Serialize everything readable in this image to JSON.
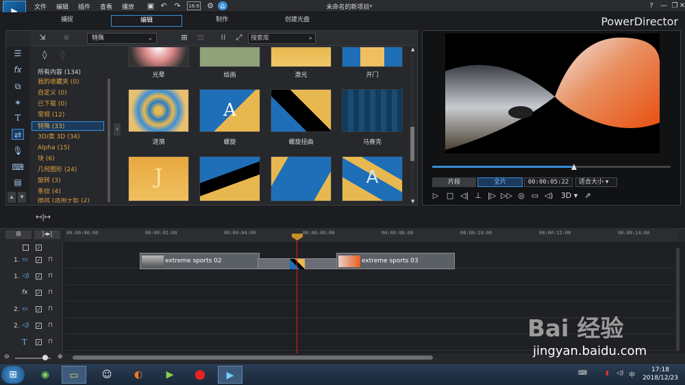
{
  "menu": [
    "文件",
    "编辑",
    "插件",
    "查看",
    "播放"
  ],
  "doc_title": "未命名的新项目*",
  "modes": {
    "capture": "捕捉",
    "edit": "编辑",
    "produce": "制作",
    "disc": "创建光盘"
  },
  "brand": "PowerDirector",
  "library": {
    "category_select": "特殊",
    "search_placeholder": "搜索库",
    "categories": [
      "所有内容 (134)",
      "我的收藏夹 (0)",
      "自定义 (0)",
      "已下载 (0)",
      "常规 (12)",
      "特殊 (33)",
      "3D/类 3D (34)",
      "Alpha (15)",
      "块 (6)",
      "几何图形 (24)",
      "旋转 (3)",
      "条纹 (4)",
      "擦拭 (适用于影 (2)"
    ],
    "thumbs_row0": [
      "光晕",
      "绘画",
      "激光",
      "开门"
    ],
    "thumbs_row1": [
      "涟漪",
      "螺旋",
      "螺旋扭曲",
      "马赛克"
    ],
    "thumbs_row2": [
      "",
      "",
      "",
      ""
    ]
  },
  "preview": {
    "clip": "片段",
    "full": "全片",
    "timecode": "00:00:05:22",
    "fit": "适合大小",
    "mode_3d": "3D"
  },
  "timeline": {
    "ticks": [
      "00:00:00:00",
      "00:00:02:00",
      "00:00:04:00",
      "00:00:06:00",
      "00:00:08:00",
      "00:00:10:00",
      "00:00:12:00",
      "00:00:14:00"
    ],
    "clip_a": "extreme sports 02",
    "clip_b": "extreme sports 03",
    "tracks": [
      "1.",
      "1.",
      "",
      "2.",
      "2.",
      "",
      ""
    ]
  },
  "taskbar": {
    "time": "17:18",
    "date": "2018/12/23"
  },
  "watermark": {
    "line1": "Bai 经验",
    "line2": "jingyan.baidu.com"
  },
  "colors": {
    "accent": "#3a8fd8",
    "category": "#e0a040",
    "playhead": "#d22222"
  }
}
